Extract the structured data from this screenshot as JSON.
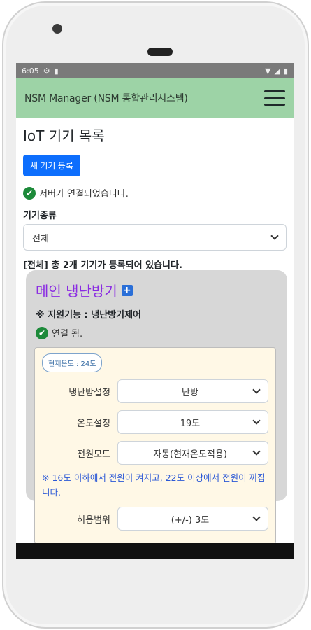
{
  "status_bar": {
    "time": "6:05"
  },
  "app_bar": {
    "title": "NSM Manager (NSM 통합관리시스템)"
  },
  "page": {
    "title": "IoT 기기 목록",
    "new_device_button": "새 기기 등록",
    "server_status": "서버가 연결되었습니다.",
    "device_type_label": "기기종류",
    "device_type_value": "전체",
    "summary": "[전체] 총 2개 기기가 등록되어 있습니다."
  },
  "device": {
    "name": "메인 냉난방기",
    "feature": "※ 지원기능 : 냉난방기제어",
    "connection_status": "연결 됨.",
    "current_temp_badge": "현재온도 : 24도",
    "controls": [
      {
        "label": "냉난방설정",
        "value": "난방"
      },
      {
        "label": "온도설정",
        "value": "19도"
      },
      {
        "label": "전원모드",
        "value": "자동(현재온도적용)"
      }
    ],
    "note": "※ 16도 이하에서 전원이 켜지고, 22도 이상에서 전원이 꺼집니다.",
    "tolerance": {
      "label": "허용범위",
      "value": "(+/-) 3도"
    }
  },
  "colors": {
    "app_bar": "#9dd3a6",
    "primary_button": "#0d6efd",
    "device_title": "#8a2be2",
    "note_text": "#2b58d6",
    "success": "#1d8a3a"
  }
}
